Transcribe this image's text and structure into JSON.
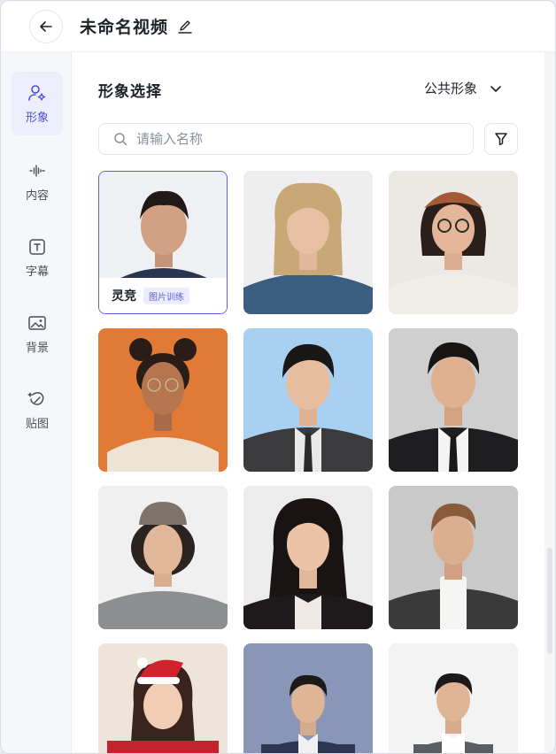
{
  "header": {
    "title": "未命名视频"
  },
  "sidebar": {
    "items": [
      {
        "label": "形象",
        "active": true
      },
      {
        "label": "内容"
      },
      {
        "label": "字幕"
      },
      {
        "label": "背景"
      },
      {
        "label": "贴图"
      }
    ]
  },
  "main": {
    "section_title": "形象选择",
    "filter_dropdown": {
      "selected": "公共形象"
    },
    "search": {
      "placeholder": "请输入名称",
      "value": ""
    },
    "avatars": [
      {
        "name": "灵竞",
        "tag": "图片训练",
        "selected": true
      },
      {
        "name": ""
      },
      {
        "name": ""
      },
      {
        "name": ""
      },
      {
        "name": ""
      },
      {
        "name": ""
      },
      {
        "name": ""
      },
      {
        "name": ""
      },
      {
        "name": ""
      },
      {
        "name": ""
      },
      {
        "name": ""
      },
      {
        "name": ""
      }
    ]
  },
  "colors": {
    "accent": "#5b5fd6",
    "sidebar_active_bg": "#eceefb",
    "card_bg": "#eef0f3"
  }
}
